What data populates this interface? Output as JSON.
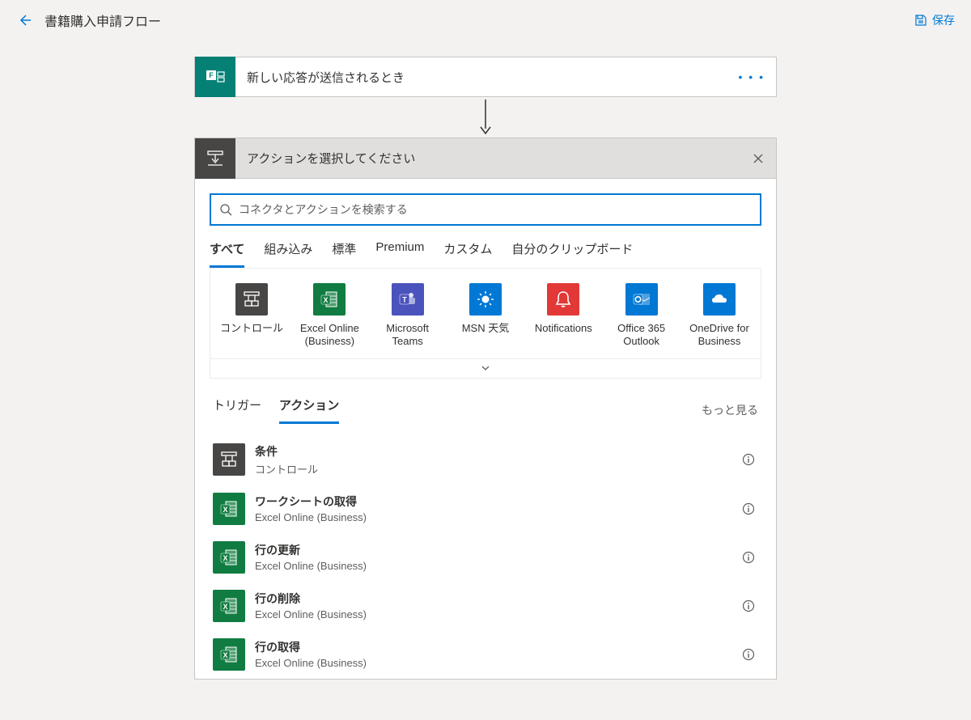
{
  "header": {
    "title": "書籍購入申請フロー",
    "save_label": "保存"
  },
  "trigger": {
    "title": "新しい応答が送信されるとき"
  },
  "picker": {
    "title": "アクションを選択してください",
    "search_placeholder": "コネクタとアクションを検索する",
    "category_tabs": [
      "すべて",
      "組み込み",
      "標準",
      "Premium",
      "カスタム",
      "自分のクリップボード"
    ],
    "connectors": [
      {
        "label": "コントロール",
        "icon": "control",
        "bg": "bg-control"
      },
      {
        "label": "Excel Online (Business)",
        "icon": "excel",
        "bg": "bg-excel"
      },
      {
        "label": "Microsoft Teams",
        "icon": "teams",
        "bg": "bg-teams"
      },
      {
        "label": "MSN 天気",
        "icon": "weather",
        "bg": "bg-msn"
      },
      {
        "label": "Notifications",
        "icon": "bell",
        "bg": "bg-notif"
      },
      {
        "label": "Office 365 Outlook",
        "icon": "outlook",
        "bg": "bg-outlook"
      },
      {
        "label": "OneDrive for Business",
        "icon": "onedrive",
        "bg": "bg-onedrive"
      }
    ],
    "ta_tabs": {
      "triggers": "トリガー",
      "actions": "アクション"
    },
    "see_more": "もっと見る",
    "actions": [
      {
        "title": "条件",
        "sub": "コントロール",
        "icon": "control",
        "bg": "bg-control"
      },
      {
        "title": "ワークシートの取得",
        "sub": "Excel Online (Business)",
        "icon": "excel",
        "bg": "bg-excel"
      },
      {
        "title": "行の更新",
        "sub": "Excel Online (Business)",
        "icon": "excel",
        "bg": "bg-excel"
      },
      {
        "title": "行の削除",
        "sub": "Excel Online (Business)",
        "icon": "excel",
        "bg": "bg-excel"
      },
      {
        "title": "行の取得",
        "sub": "Excel Online (Business)",
        "icon": "excel",
        "bg": "bg-excel"
      }
    ]
  }
}
